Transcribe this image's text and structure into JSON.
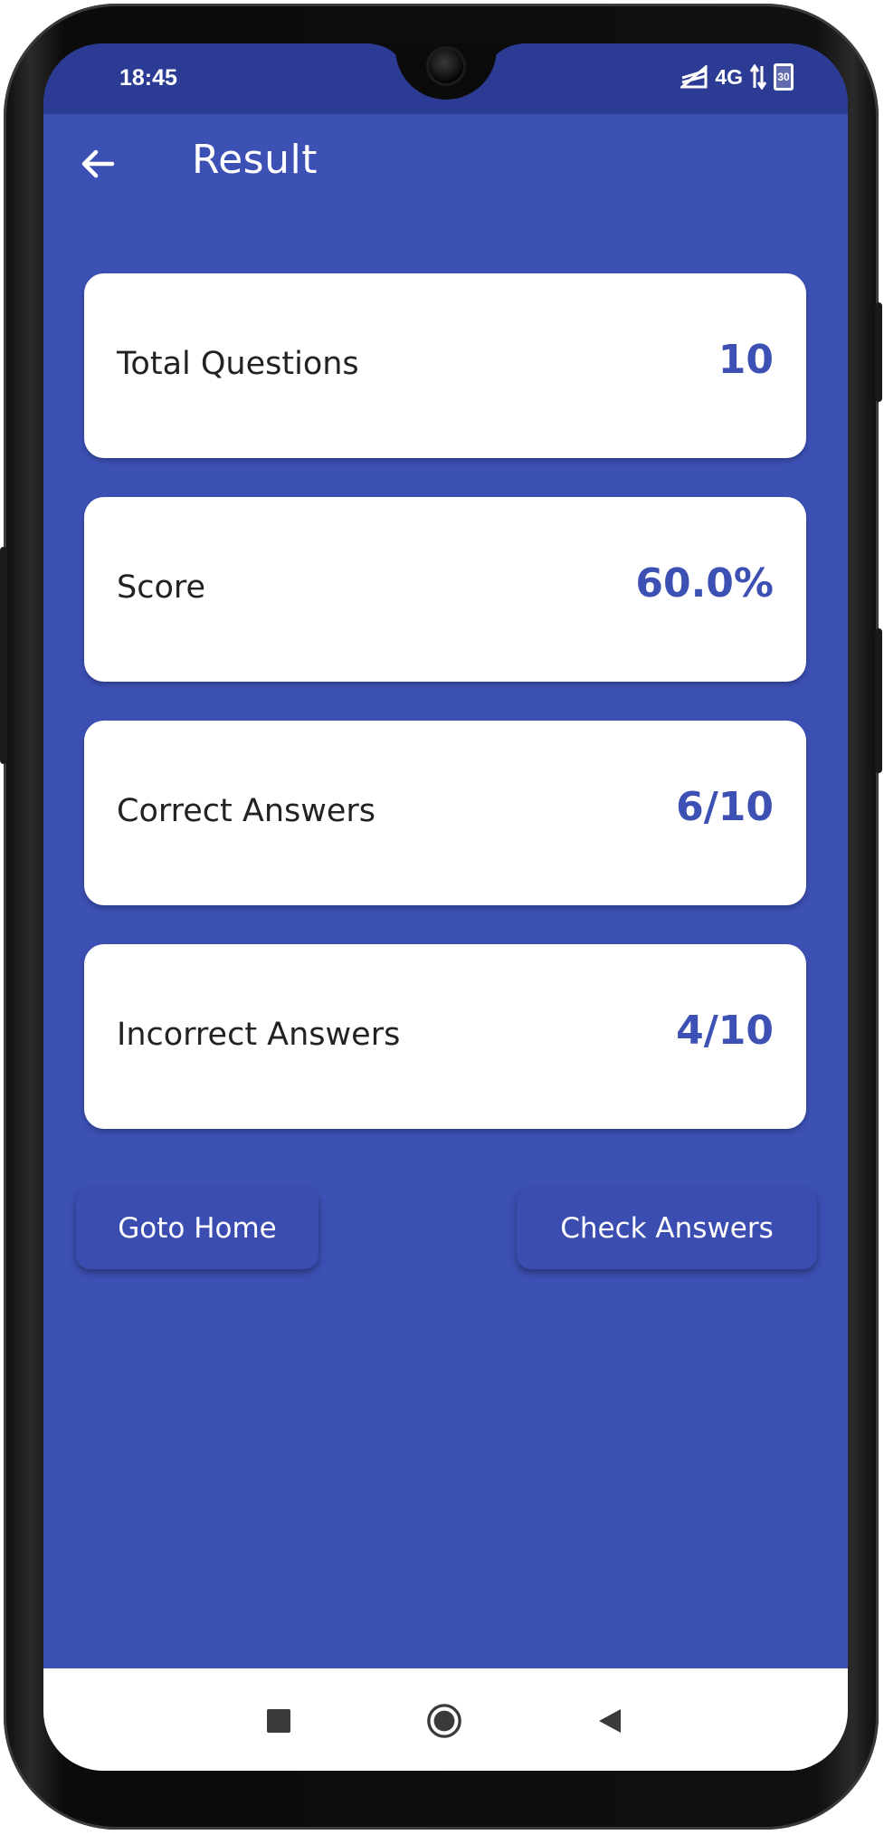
{
  "status_bar": {
    "time": "18:45",
    "network": "4G",
    "battery": "30",
    "signal_icon": "signal-icon",
    "data_icon": "data-transfer-icon"
  },
  "app_bar": {
    "title": "Result",
    "back_icon": "arrow-back-icon"
  },
  "results": [
    {
      "label": "Total Questions",
      "value": "10"
    },
    {
      "label": "Score",
      "value": "60.0%"
    },
    {
      "label": "Correct Answers",
      "value": "6/10"
    },
    {
      "label": "Incorrect Answers",
      "value": "4/10"
    }
  ],
  "actions": {
    "home_label": "Goto Home",
    "check_label": "Check Answers"
  },
  "nav_bar": {
    "recents_icon": "square-icon",
    "home_icon": "circle-icon",
    "back_icon": "triangle-back-icon"
  },
  "colors": {
    "primary": "#3d50b4",
    "status_bar": "#2c3b94",
    "card": "#ffffff",
    "value_text": "#3d50b4"
  }
}
